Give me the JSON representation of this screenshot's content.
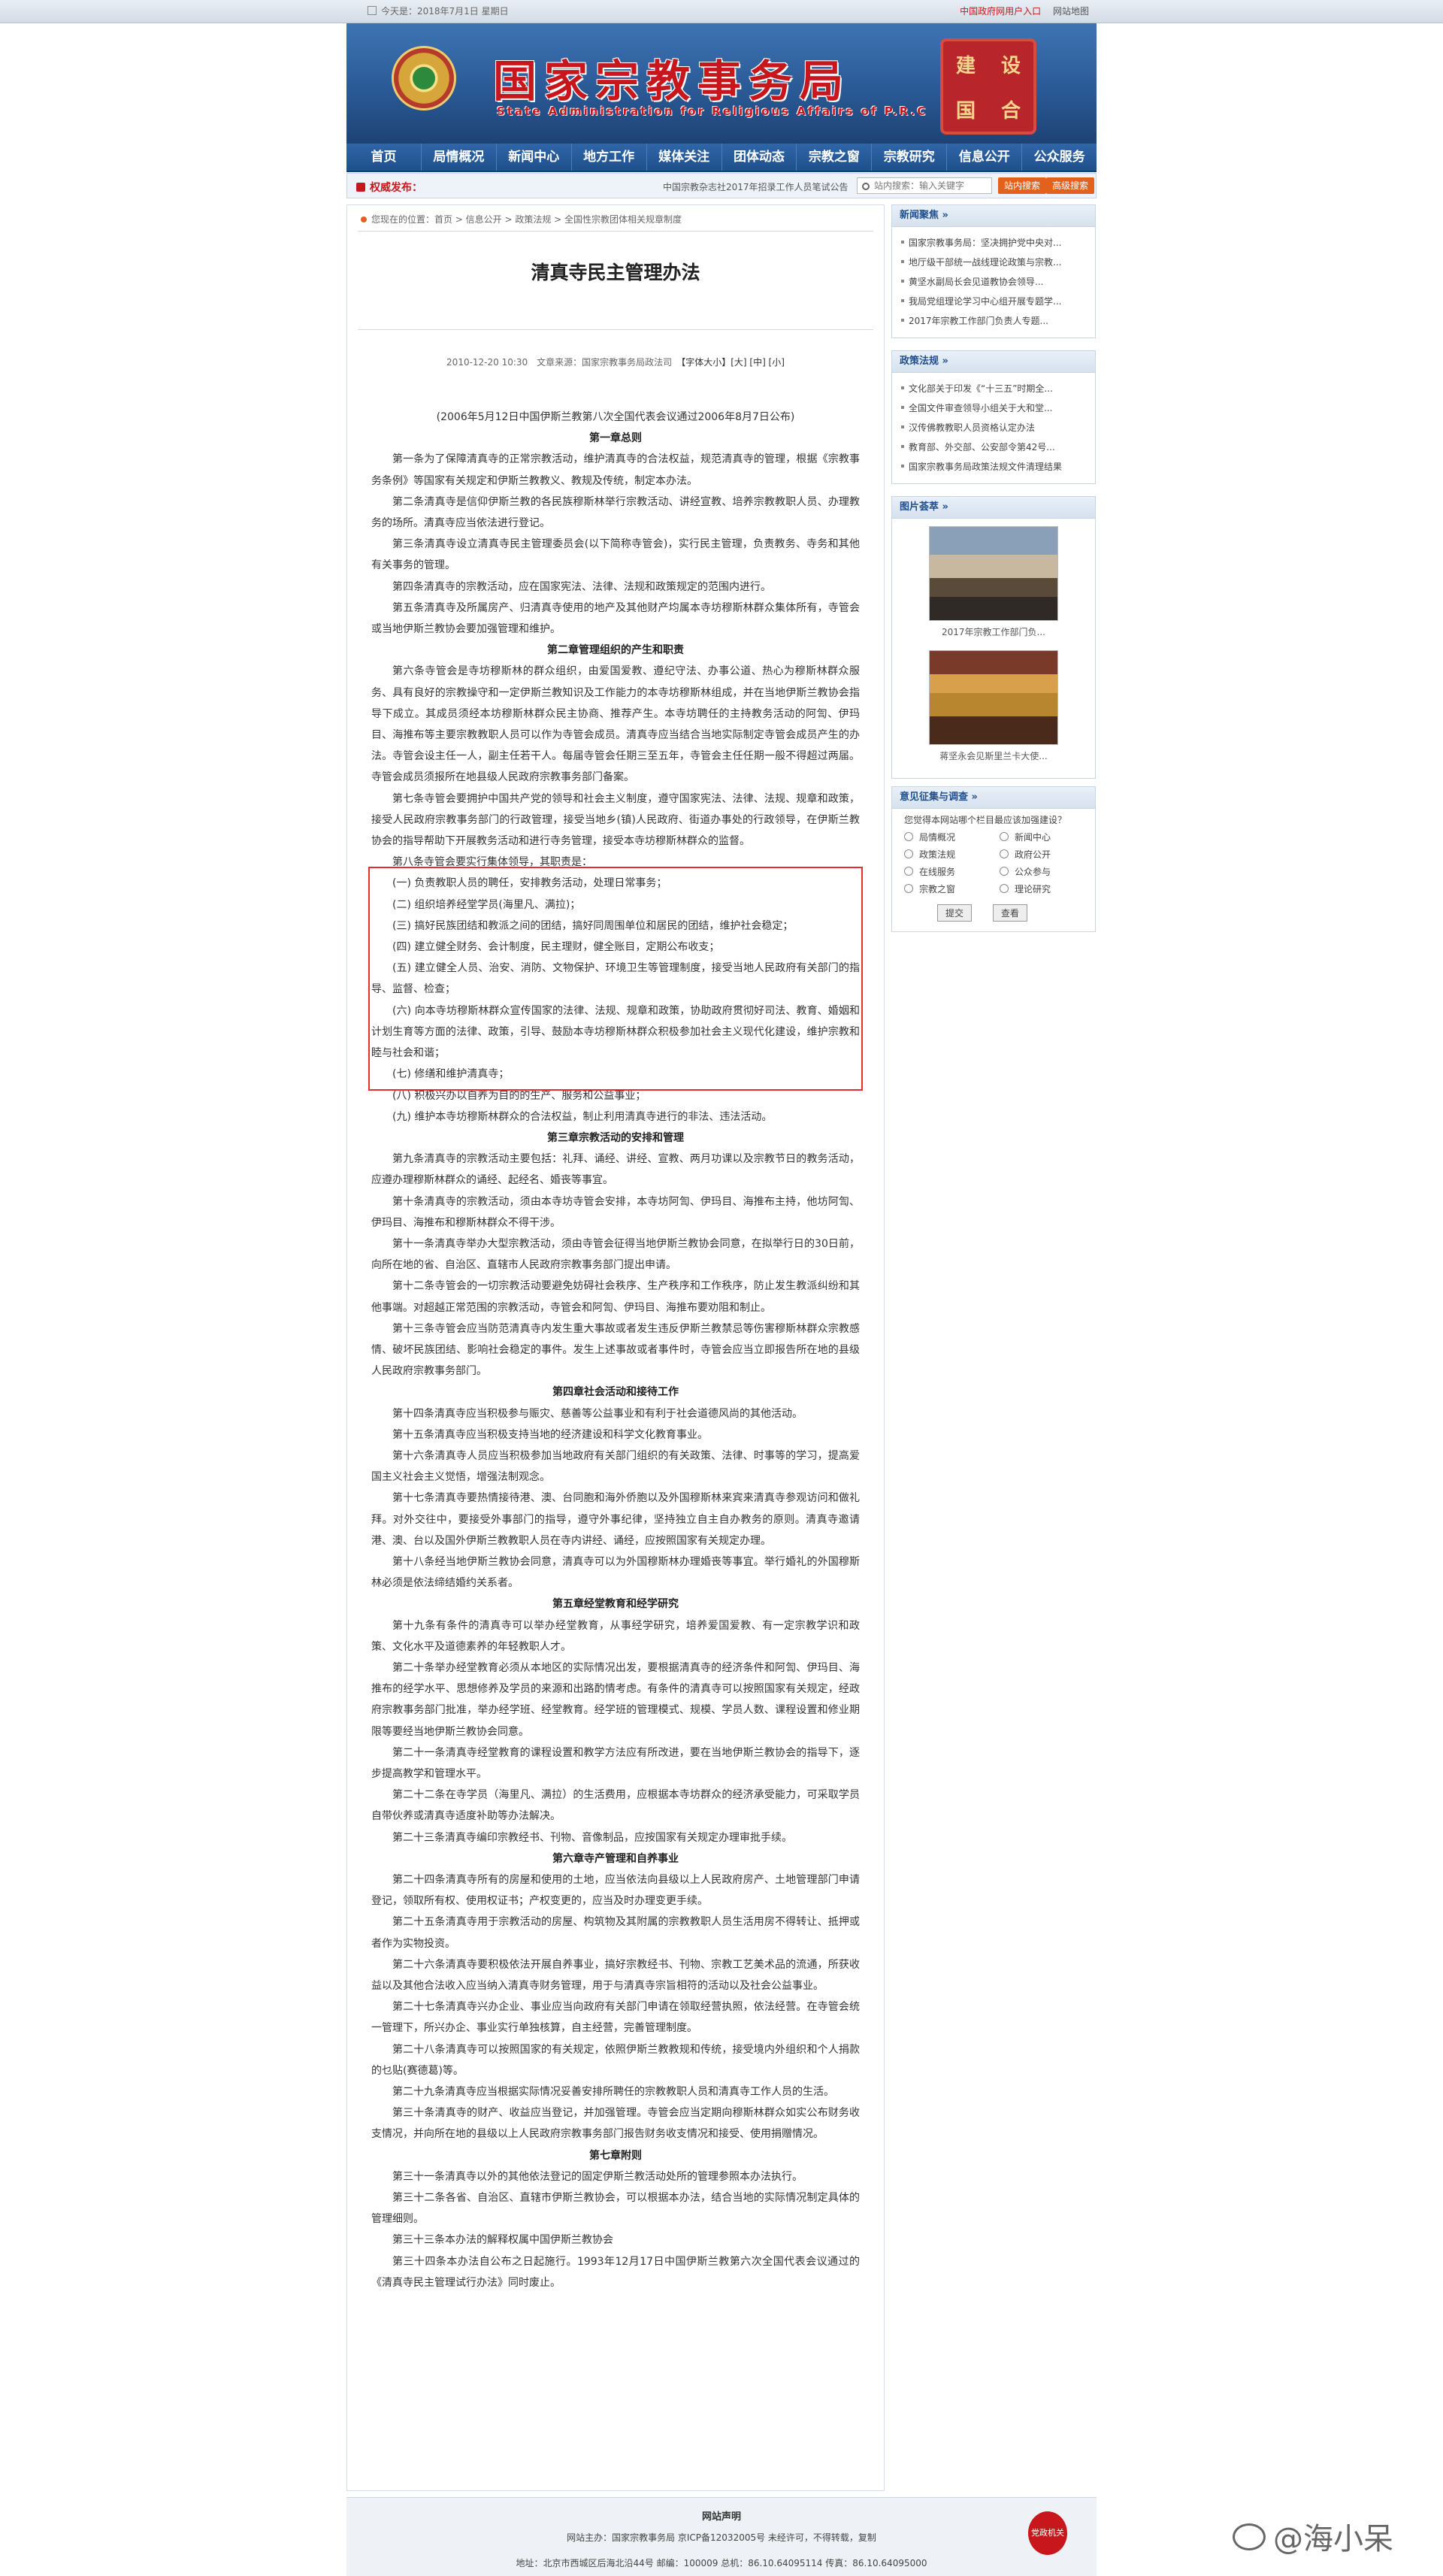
{
  "topbar": {
    "date": "今天是：2018年7月1日 星期日",
    "link1": "中国政府网用户入口",
    "link2": "网站地图"
  },
  "banner": {
    "title_cn": "国家宗教事务局",
    "title_en": "State Administration for Religious Affairs of P.R.C",
    "seal_chars": [
      "建",
      "设",
      "国",
      "合"
    ]
  },
  "nav": [
    "首页",
    "局情概况",
    "新闻中心",
    "地方工作",
    "媒体关注",
    "团体动态",
    "宗教之窗",
    "宗教研究",
    "信息公开",
    "公众服务"
  ],
  "notice": {
    "label": "权威发布：",
    "scroll": "中国宗教杂志社2017年招录工作人员笔试公告",
    "search_placeholder": "站内搜索：输入关键字",
    "btn_site": "站内搜索",
    "btn_adv": "高级搜索"
  },
  "article": {
    "crumb": "您现在的位置：首页 > 信息公开 > 政策法规 > 全国性宗教团体相关规章制度",
    "title": "清真寺民主管理办法",
    "meta": "2010-12-20 10:30　文章来源：国家宗教事务局政法司",
    "font_size_label": "【字体大小】[大] [中] [小]",
    "paragraphs": [
      {
        "t": "(2006年5月12日中国伊斯兰教第八次全国代表会议通过2006年8月7日公布)",
        "c": "center"
      },
      {
        "t": "第一章总则",
        "c": "chapter"
      },
      {
        "t": "第一条为了保障清真寺的正常宗教活动，维护清真寺的合法权益，规范清真寺的管理，根据《宗教事务条例》等国家有关规定和伊斯兰教教义、教规及传统，制定本办法。",
        "c": ""
      },
      {
        "t": "第二条清真寺是信仰伊斯兰教的各民族穆斯林举行宗教活动、讲经宣教、培养宗教教职人员、办理教务的场所。清真寺应当依法进行登记。",
        "c": ""
      },
      {
        "t": "第三条清真寺设立清真寺民主管理委员会(以下简称寺管会)，实行民主管理，负责教务、寺务和其他有关事务的管理。",
        "c": ""
      },
      {
        "t": "第四条清真寺的宗教活动，应在国家宪法、法律、法规和政策规定的范围内进行。",
        "c": ""
      },
      {
        "t": "第五条清真寺及所属房产、归清真寺使用的地产及其他财产均属本寺坊穆斯林群众集体所有，寺管会或当地伊斯兰教协会要加强管理和维护。",
        "c": ""
      },
      {
        "t": "第二章管理组织的产生和职责",
        "c": "chapter"
      },
      {
        "t": "第六条寺管会是寺坊穆斯林的群众组织，由爱国爱教、遵纪守法、办事公道、热心为穆斯林群众服务、具有良好的宗教操守和一定伊斯兰教知识及工作能力的本寺坊穆斯林组成，并在当地伊斯兰教协会指导下成立。其成员须经本坊穆斯林群众民主协商、推荐产生。本寺坊聘任的主持教务活动的阿訇、伊玛目、海推布等主要宗教教职人员可以作为寺管会成员。清真寺应当结合当地实际制定寺管会成员产生的办法。寺管会设主任一人，副主任若干人。每届寺管会任期三至五年，寺管会主任任期一般不得超过两届。寺管会成员须报所在地县级人民政府宗教事务部门备案。",
        "c": ""
      },
      {
        "t": "第七条寺管会要拥护中国共产党的领导和社会主义制度，遵守国家宪法、法律、法规、规章和政策，接受人民政府宗教事务部门的行政管理，接受当地乡(镇)人民政府、街道办事处的行政领导，在伊斯兰教协会的指导帮助下开展教务活动和进行寺务管理，接受本寺坊穆斯林群众的监督。",
        "c": ""
      },
      {
        "t": "第八条寺管会要实行集体领导，其职责是：",
        "c": ""
      },
      {
        "t": "(一) 负责教职人员的聘任，安排教务活动，处理日常事务；",
        "c": ""
      },
      {
        "t": "(二) 组织培养经堂学员(海里凡、满拉)；",
        "c": ""
      },
      {
        "t": "(三) 搞好民族团结和教派之间的团结，搞好同周围单位和居民的团结，维护社会稳定；",
        "c": ""
      },
      {
        "t": "(四) 建立健全财务、会计制度，民主理财，健全账目，定期公布收支；",
        "c": ""
      },
      {
        "t": "(五) 建立健全人员、治安、消防、文物保护、环境卫生等管理制度，接受当地人民政府有关部门的指导、监督、检查；",
        "c": ""
      },
      {
        "t": "(六) 向本寺坊穆斯林群众宣传国家的法律、法规、规章和政策，协助政府贯彻好司法、教育、婚姻和计划生育等方面的法律、政策，引导、鼓励本寺坊穆斯林群众积极参加社会主义现代化建设，维护宗教和睦与社会和谐；",
        "c": ""
      },
      {
        "t": "(七) 修缮和维护清真寺；",
        "c": ""
      },
      {
        "t": "(八) 积极兴办以自养为目的的生产、服务和公益事业；",
        "c": ""
      },
      {
        "t": "(九) 维护本寺坊穆斯林群众的合法权益，制止利用清真寺进行的非法、违法活动。",
        "c": ""
      },
      {
        "t": "第三章宗教活动的安排和管理",
        "c": "chapter"
      },
      {
        "t": "第九条清真寺的宗教活动主要包括：礼拜、诵经、讲经、宣教、两月功课以及宗教节日的教务活动，应遵办理穆斯林群众的诵经、起经名、婚丧等事宜。",
        "c": ""
      },
      {
        "t": "第十条清真寺的宗教活动，须由本寺坊寺管会安排，本寺坊阿訇、伊玛目、海推布主持，他坊阿訇、伊玛目、海推布和穆斯林群众不得干涉。",
        "c": ""
      },
      {
        "t": "第十一条清真寺举办大型宗教活动，须由寺管会征得当地伊斯兰教协会同意，在拟举行日的30日前，向所在地的省、自治区、直辖市人民政府宗教事务部门提出申请。",
        "c": ""
      },
      {
        "t": "第十二条寺管会的一切宗教活动要避免妨碍社会秩序、生产秩序和工作秩序，防止发生教派纠纷和其他事端。对超越正常范围的宗教活动，寺管会和阿訇、伊玛目、海推布要劝阻和制止。",
        "c": ""
      },
      {
        "t": "第十三条寺管会应当防范清真寺内发生重大事故或者发生违反伊斯兰教禁忌等伤害穆斯林群众宗教感情、破坏民族团结、影响社会稳定的事件。发生上述事故或者事件时，寺管会应当立即报告所在地的县级人民政府宗教事务部门。",
        "c": ""
      },
      {
        "t": "第四章社会活动和接待工作",
        "c": "chapter"
      },
      {
        "t": "第十四条清真寺应当积极参与赈灾、慈善等公益事业和有利于社会道德风尚的其他活动。",
        "c": ""
      },
      {
        "t": "第十五条清真寺应当积极支持当地的经济建设和科学文化教育事业。",
        "c": ""
      },
      {
        "t": "第十六条清真寺人员应当积极参加当地政府有关部门组织的有关政策、法律、时事等的学习，提高爱国主义社会主义觉悟，增强法制观念。",
        "c": ""
      },
      {
        "t": "第十七条清真寺要热情接待港、澳、台同胞和海外侨胞以及外国穆斯林来宾来清真寺参观访问和做礼拜。对外交往中，要接受外事部门的指导，遵守外事纪律，坚持独立自主自办教务的原则。清真寺邀请港、澳、台以及国外伊斯兰教教职人员在寺内讲经、诵经，应按照国家有关规定办理。",
        "c": ""
      },
      {
        "t": "第十八条经当地伊斯兰教协会同意，清真寺可以为外国穆斯林办理婚丧等事宜。举行婚礼的外国穆斯林必须是依法缔结婚约关系者。",
        "c": ""
      },
      {
        "t": "第五章经堂教育和经学研究",
        "c": "chapter"
      },
      {
        "t": "第十九条有条件的清真寺可以举办经堂教育，从事经学研究，培养爱国爱教、有一定宗教学识和政策、文化水平及道德素养的年轻教职人才。",
        "c": ""
      },
      {
        "t": "第二十条举办经堂教育必须从本地区的实际情况出发，要根据清真寺的经济条件和阿訇、伊玛目、海推布的经学水平、思想修养及学员的来源和出路酌情考虑。有条件的清真寺可以按照国家有关规定，经政府宗教事务部门批准，举办经学班、经堂教育。经学班的管理模式、规模、学员人数、课程设置和修业期限等要经当地伊斯兰教协会同意。",
        "c": ""
      },
      {
        "t": "第二十一条清真寺经堂教育的课程设置和教学方法应有所改进，要在当地伊斯兰教协会的指导下，逐步提高教学和管理水平。",
        "c": ""
      },
      {
        "t": "第二十二条在寺学员（海里凡、满拉）的生活费用，应根据本寺坊群众的经济承受能力，可采取学员自带伙养或清真寺适度补助等办法解决。",
        "c": ""
      },
      {
        "t": "第二十三条清真寺编印宗教经书、刊物、音像制品，应按国家有关规定办理审批手续。",
        "c": ""
      },
      {
        "t": "第六章寺产管理和自养事业",
        "c": "chapter"
      },
      {
        "t": "第二十四条清真寺所有的房屋和使用的土地，应当依法向县级以上人民政府房产、土地管理部门申请登记，领取所有权、使用权证书；产权变更的，应当及时办理变更手续。",
        "c": ""
      },
      {
        "t": "第二十五条清真寺用于宗教活动的房屋、构筑物及其附属的宗教教职人员生活用房不得转让、抵押或者作为实物投资。",
        "c": ""
      },
      {
        "t": "第二十六条清真寺要积极依法开展自养事业，搞好宗教经书、刊物、宗教工艺美术品的流通，所获收益以及其他合法收入应当纳入清真寺财务管理，用于与清真寺宗旨相符的活动以及社会公益事业。",
        "c": ""
      },
      {
        "t": "第二十七条清真寺兴办企业、事业应当向政府有关部门申请在领取经营执照，依法经营。在寺管会统一管理下，所兴办企、事业实行单独核算，自主经营，完善管理制度。",
        "c": ""
      },
      {
        "t": "第二十八条清真寺可以按照国家的有关规定，依照伊斯兰教教规和传统，接受境内外组织和个人捐款的乜贴(赛德葛)等。",
        "c": ""
      },
      {
        "t": "第二十九条清真寺应当根据实际情况妥善安排所聘任的宗教教职人员和清真寺工作人员的生活。",
        "c": ""
      },
      {
        "t": "第三十条清真寺的财产、收益应当登记，并加强管理。寺管会应当定期向穆斯林群众如实公布财务收支情况，并向所在地的县级以上人民政府宗教事务部门报告财务收支情况和接受、使用捐赠情况。",
        "c": ""
      },
      {
        "t": "第七章附则",
        "c": "chapter"
      },
      {
        "t": "第三十一条清真寺以外的其他依法登记的固定伊斯兰教活动处所的管理参照本办法执行。",
        "c": ""
      },
      {
        "t": "第三十二条各省、自治区、直辖市伊斯兰教协会，可以根据本办法，结合当地的实际情况制定具体的管理细则。",
        "c": ""
      },
      {
        "t": "第三十三条本办法的解释权属中国伊斯兰教协会",
        "c": ""
      },
      {
        "t": "第三十四条本办法自公布之日起施行。1993年12月17日中国伊斯兰教第六次全国代表会议通过的《清真寺民主管理试行办法》同时废止。",
        "c": ""
      }
    ]
  },
  "sidebar": {
    "news_title": "新闻聚焦 »",
    "news": [
      "国家宗教事务局：坚决拥护党中央对...",
      "地厅级干部统一战线理论政策与宗教...",
      "黄坚水副局长会见道教协会领导...",
      "我局党组理论学习中心组开展专题学...",
      "2017年宗教工作部门负责人专题..."
    ],
    "policy_title": "政策法规 »",
    "policy": [
      "文化部关于印发《“十三五”时期全...",
      "全国文件审查领导小组关于大和堂...",
      "汉传佛教教职人员资格认定办法",
      "教育部、外交部、公安部令第42号...",
      "国家宗教事务局政策法规文件清理结果"
    ],
    "photo_title": "图片荟萃 »",
    "photo1_caption": "2017年宗教工作部门负...",
    "photo2_caption": "蒋坚永会见斯里兰卡大使...",
    "survey_title": "意见征集与调查 »",
    "survey_q": "您觉得本网站哪个栏目最应该加强建设？",
    "survey_opts": [
      "局情概况",
      "新闻中心",
      "政策法规",
      "政府公开",
      "在线服务",
      "公众参与",
      "宗教之窗",
      "理论研究"
    ],
    "survey_submit": "提交",
    "survey_view": "查看"
  },
  "footer": {
    "line1": "网站声明",
    "line2": "网站主办：国家宗教事务局 京ICP备12032005号 未经许可，不得转载，复制",
    "line3": "地址：北京市西城区后海北沿44号 邮编：100009 总机：86.10.64095114 传真：86.10.64095000",
    "badge": "党政机关"
  },
  "watermark": "@海小呆"
}
